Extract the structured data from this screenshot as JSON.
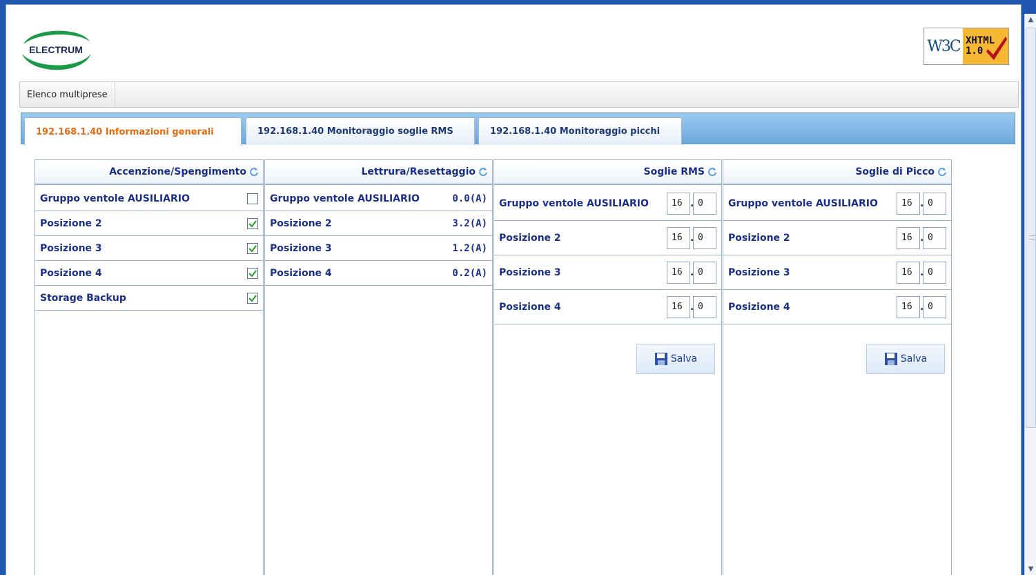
{
  "header": {
    "logo_text": "ELECTRUM",
    "badge": {
      "left": "W3C",
      "line1": "XHTML",
      "line2": "1.0"
    }
  },
  "menubar": {
    "items": [
      {
        "label": "Elenco multiprese"
      }
    ]
  },
  "tabs": [
    {
      "label": "192.168.1.40 Informazioni generali",
      "active": true
    },
    {
      "label": "192.168.1.40 Monitoraggio soglie RMS",
      "active": false
    },
    {
      "label": "192.168.1.40 Monitoraggio picchi",
      "active": false
    }
  ],
  "panels": {
    "power": {
      "title": "Accenzione/Spengimento",
      "rows": [
        {
          "label": "Gruppo ventole AUSILIARIO",
          "checked": false
        },
        {
          "label": "Posizione 2",
          "checked": true
        },
        {
          "label": "Posizione 3",
          "checked": true
        },
        {
          "label": "Posizione 4",
          "checked": true
        },
        {
          "label": "Storage Backup",
          "checked": true
        }
      ]
    },
    "reading": {
      "title": "Lettrura/Resettaggio",
      "rows": [
        {
          "label": "Gruppo ventole AUSILIARIO",
          "value": "0.0(A)"
        },
        {
          "label": "Posizione 2",
          "value": "3.2(A)"
        },
        {
          "label": "Posizione 3",
          "value": "1.2(A)"
        },
        {
          "label": "Posizione 4",
          "value": "0.2(A)"
        }
      ]
    },
    "rms": {
      "title": "Soglie RMS",
      "rows": [
        {
          "label": "Gruppo ventole AUSILIARIO",
          "int": "16",
          "dec": "0"
        },
        {
          "label": "Posizione 2",
          "int": "16",
          "dec": "0"
        },
        {
          "label": "Posizione 3",
          "int": "16",
          "dec": "0"
        },
        {
          "label": "Posizione 4",
          "int": "16",
          "dec": "0"
        }
      ],
      "save_label": "Salva"
    },
    "peak": {
      "title": "Soglie di Picco",
      "rows": [
        {
          "label": "Gruppo ventole AUSILIARIO",
          "int": "16",
          "dec": "0"
        },
        {
          "label": "Posizione 2",
          "int": "16",
          "dec": "0"
        },
        {
          "label": "Posizione 3",
          "int": "16",
          "dec": "0"
        },
        {
          "label": "Posizione 4",
          "int": "16",
          "dec": "0"
        }
      ],
      "save_label": "Salva"
    }
  },
  "colors": {
    "accent": "#e86b0f",
    "text_blue": "#1a2f8a",
    "desktop": "#1f56b0"
  }
}
